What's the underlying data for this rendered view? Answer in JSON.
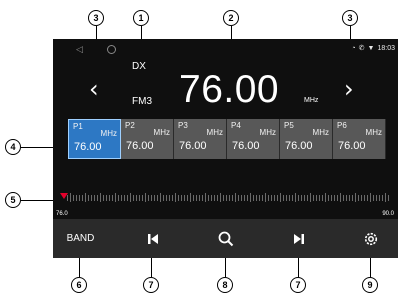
{
  "status_bar": {
    "time": "18:03"
  },
  "radio": {
    "mode": "DX",
    "band": "FM3",
    "frequency": "76.00",
    "unit": "MHz"
  },
  "presets": [
    {
      "label": "P1",
      "unit": "MHz",
      "frequency": "76.00",
      "selected": true
    },
    {
      "label": "P2",
      "unit": "MHz",
      "frequency": "76.00",
      "selected": false
    },
    {
      "label": "P3",
      "unit": "MHz",
      "frequency": "76.00",
      "selected": false
    },
    {
      "label": "P4",
      "unit": "MHz",
      "frequency": "76.00",
      "selected": false
    },
    {
      "label": "P5",
      "unit": "MHz",
      "frequency": "76.00",
      "selected": false
    },
    {
      "label": "P6",
      "unit": "MHz",
      "frequency": "76.00",
      "selected": false
    }
  ],
  "tuner": {
    "min": "76.0",
    "max": "90.0",
    "position": 0.0
  },
  "controls": {
    "band_label": "BAND",
    "icons": [
      "skip-previous-icon",
      "search-icon",
      "skip-next-icon",
      "settings-icon"
    ]
  },
  "callouts": [
    "1",
    "2",
    "3",
    "3",
    "4",
    "5",
    "6",
    "7",
    "8",
    "7",
    "9"
  ],
  "colors": {
    "screen_bg": "#0f0f0f",
    "preset_bg": "#585858",
    "preset_active": "#2d78c4",
    "needle": "#e4002b",
    "bar_bg": "#2a2a2a"
  }
}
